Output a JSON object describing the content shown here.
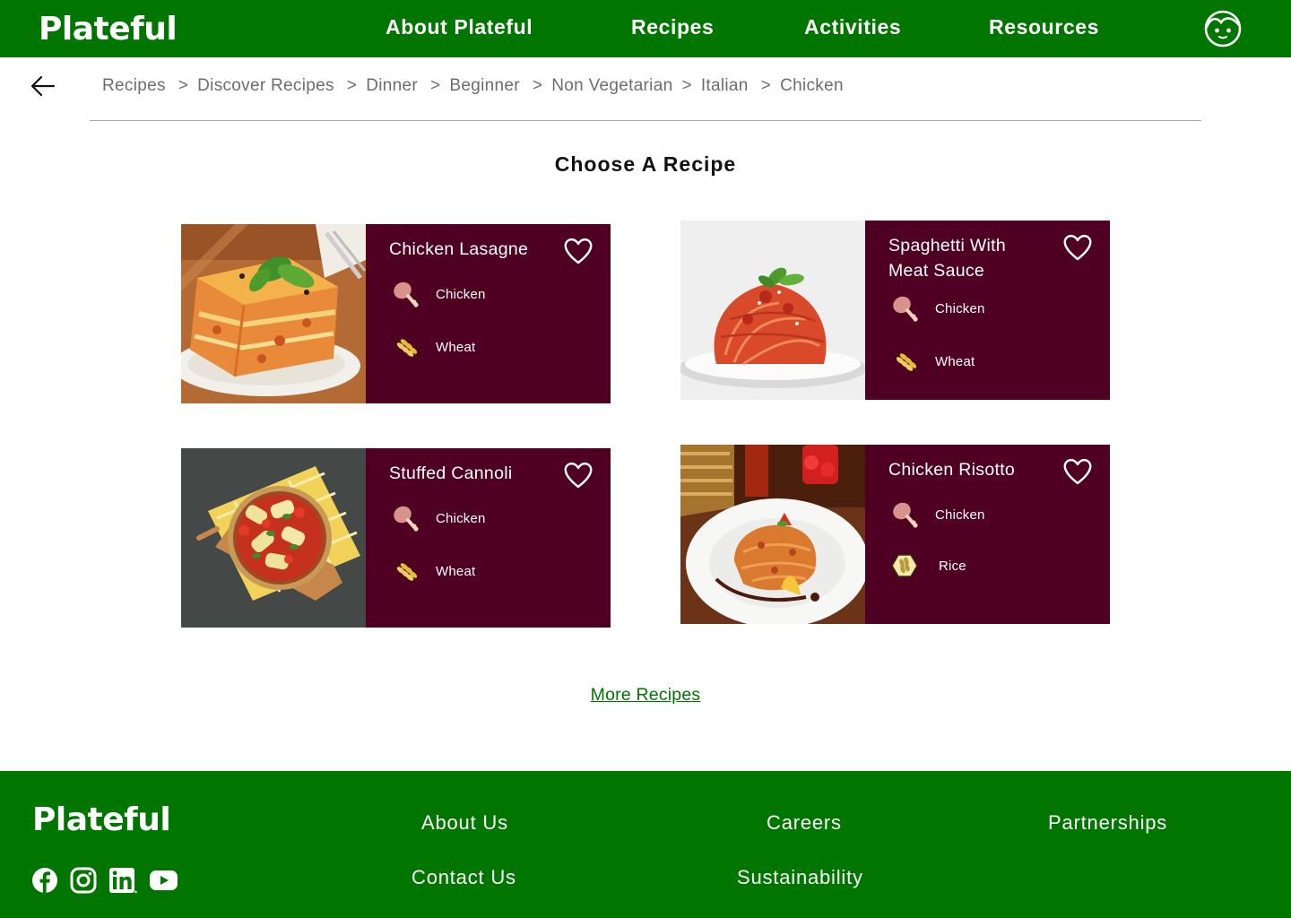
{
  "header": {
    "logo": "Plateful",
    "nav": [
      "About Plateful",
      "Recipes",
      "Activities",
      "Resources"
    ]
  },
  "breadcrumb": [
    "Recipes",
    "Discover Recipes",
    "Dinner",
    "Beginner",
    "Non Vegetarian",
    "Italian",
    "Chicken"
  ],
  "breadcrumb_separator": ">",
  "page_title": "Choose A Recipe",
  "recipes": [
    {
      "title": "Chicken Lasagne",
      "ingredients": [
        {
          "label": "Chicken",
          "icon": "chicken-leg-icon"
        },
        {
          "label": "Wheat",
          "icon": "wheat-icon"
        }
      ]
    },
    {
      "title": "Spaghetti With Meat Sauce",
      "ingredients": [
        {
          "label": "Chicken",
          "icon": "chicken-leg-icon"
        },
        {
          "label": "Wheat",
          "icon": "wheat-icon"
        }
      ]
    },
    {
      "title": "Stuffed Cannoli",
      "ingredients": [
        {
          "label": "Chicken",
          "icon": "chicken-leg-icon"
        },
        {
          "label": "Wheat",
          "icon": "wheat-icon"
        }
      ]
    },
    {
      "title": "Chicken Risotto",
      "ingredients": [
        {
          "label": "Chicken",
          "icon": "chicken-leg-icon"
        },
        {
          "label": "Rice",
          "icon": "rice-icon"
        }
      ]
    }
  ],
  "more_recipes": "More Recipes",
  "footer": {
    "logo": "Plateful",
    "links": [
      "About Us",
      "Careers",
      "Partnerships",
      "Contact Us",
      "Sustainability"
    ],
    "social": [
      "facebook-icon",
      "instagram-icon",
      "linkedin-icon",
      "youtube-icon"
    ]
  },
  "colors": {
    "brand_green": "#007500",
    "card_maroon": "#4f0022",
    "text_grey": "#6d6d6d"
  }
}
